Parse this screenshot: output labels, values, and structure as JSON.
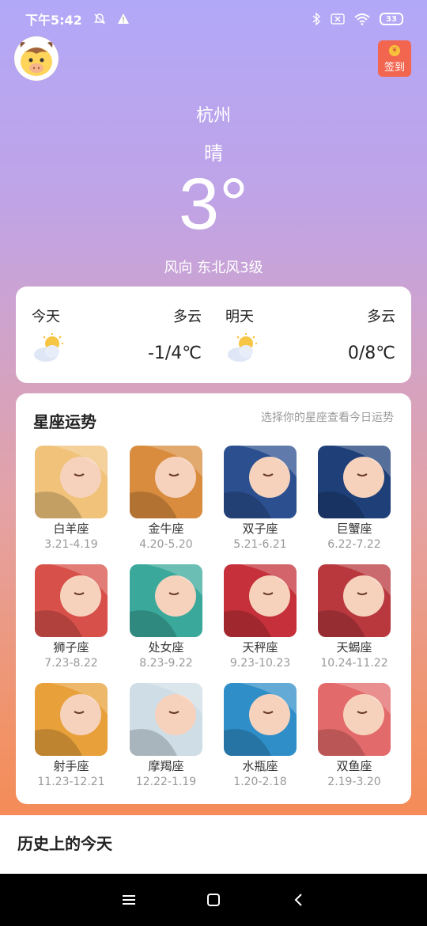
{
  "status": {
    "time": "下午5:42",
    "battery": "33"
  },
  "header": {
    "checkin_label": "签到",
    "checkin_coin": "¥"
  },
  "weather": {
    "city": "杭州",
    "condition": "晴",
    "temperature": "3°",
    "wind": "风向 东北风3级"
  },
  "forecast": [
    {
      "day": "今天",
      "condition": "多云",
      "range": "-1/4℃",
      "icon": "partly-cloudy-icon"
    },
    {
      "day": "明天",
      "condition": "多云",
      "range": "0/8℃",
      "icon": "partly-cloudy-icon"
    }
  ],
  "zodiac": {
    "title": "星座运势",
    "hint": "选择你的星座查看今日运势",
    "items": [
      {
        "name": "白羊座",
        "dates": "3.21-4.19",
        "color": "#f0c27a"
      },
      {
        "name": "金牛座",
        "dates": "4.20-5.20",
        "color": "#d98c3e"
      },
      {
        "name": "双子座",
        "dates": "5.21-6.21",
        "color": "#2b4f8f"
      },
      {
        "name": "巨蟹座",
        "dates": "6.22-7.22",
        "color": "#1e3f78"
      },
      {
        "name": "狮子座",
        "dates": "7.23-8.22",
        "color": "#d8504a"
      },
      {
        "name": "处女座",
        "dates": "8.23-9.22",
        "color": "#3aa89a"
      },
      {
        "name": "天秤座",
        "dates": "9.23-10.23",
        "color": "#c5303a"
      },
      {
        "name": "天蝎座",
        "dates": "10.24-11.22",
        "color": "#b8383e"
      },
      {
        "name": "射手座",
        "dates": "11.23-12.21",
        "color": "#e8a13a"
      },
      {
        "name": "摩羯座",
        "dates": "12.22-1.19",
        "color": "#cfdde6"
      },
      {
        "name": "水瓶座",
        "dates": "1.20-2.18",
        "color": "#2f8ec8"
      },
      {
        "name": "双鱼座",
        "dates": "2.19-3.20",
        "color": "#e36a6a"
      }
    ]
  },
  "history": {
    "title": "历史上的今天"
  }
}
